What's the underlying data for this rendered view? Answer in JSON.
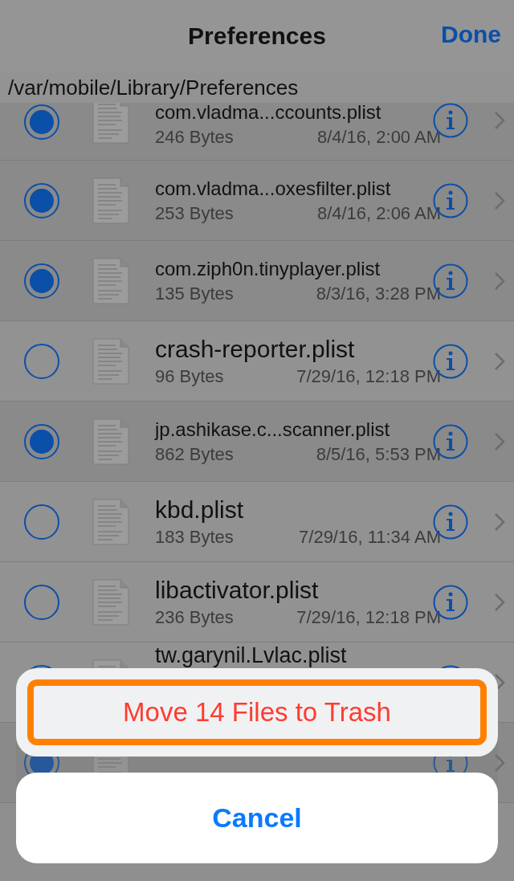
{
  "nav": {
    "title": "Preferences",
    "done": "Done"
  },
  "path": "/var/mobile/Library/Preferences",
  "files": [
    {
      "name": "com.vladma...ccounts.plist",
      "size": "246 Bytes",
      "date": "8/4/16, 2:00 AM",
      "selected": true
    },
    {
      "name": "com.vladma...oxesfilter.plist",
      "size": "253 Bytes",
      "date": "8/4/16, 2:06 AM",
      "selected": true
    },
    {
      "name": "com.ziph0n.tinyplayer.plist",
      "size": "135 Bytes",
      "date": "8/3/16, 3:28 PM",
      "selected": true
    },
    {
      "name": "crash-reporter.plist",
      "size": "96 Bytes",
      "date": "7/29/16, 12:18 PM",
      "selected": false
    },
    {
      "name": "jp.ashikase.c...scanner.plist",
      "size": "862 Bytes",
      "date": "8/5/16, 5:53 PM",
      "selected": true
    },
    {
      "name": "kbd.plist",
      "size": "183 Bytes",
      "date": "7/29/16, 11:34 AM",
      "selected": false
    },
    {
      "name": "libactivator.plist",
      "size": "236 Bytes",
      "date": "7/29/16, 12:18 PM",
      "selected": false
    },
    {
      "name": "tw.garynil.Lvlac.plist"
    },
    {
      "selected": true
    }
  ],
  "sheet": {
    "action": "Move 14 Files to Trash",
    "cancel": "Cancel"
  }
}
